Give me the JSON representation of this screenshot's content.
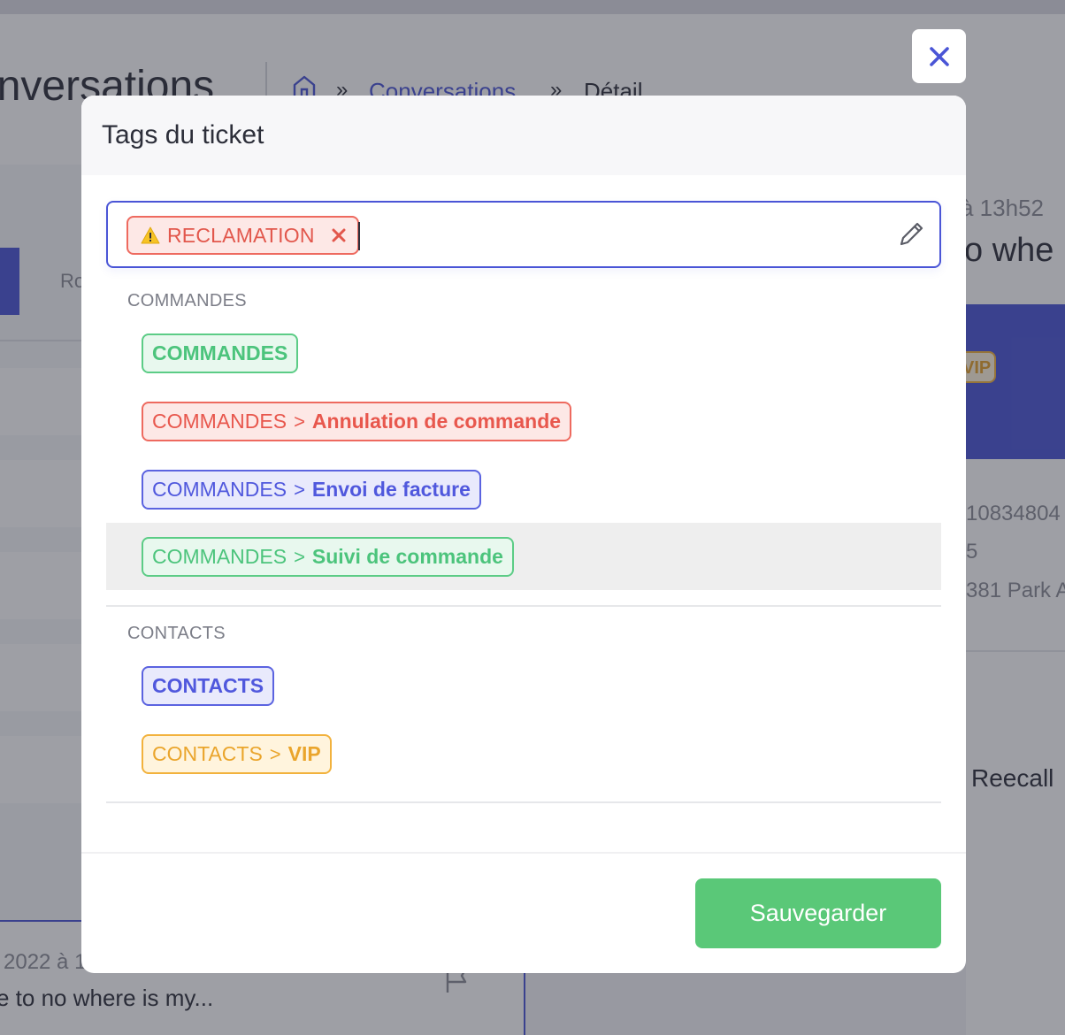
{
  "background": {
    "page_title": "onversations",
    "breadcrumb": {
      "link": "Conversations",
      "current": "Détail",
      "separator": "»"
    },
    "left": {
      "tab_label": "Ro",
      "card_date": "2022 à 1",
      "card_text": "e to no where is my..."
    },
    "right": {
      "time": "à 13h52",
      "heading": "o whe",
      "vip_badge": "VIP",
      "info_1": "10834804",
      "info_2": "5",
      "info_3": "381 Park A",
      "reecall": "Reecall"
    }
  },
  "modal": {
    "title": "Tags du ticket",
    "selected_tag": {
      "label": "RECLAMATION",
      "icon": "warning-icon"
    },
    "groups": [
      {
        "label": "COMMANDES",
        "options": [
          {
            "root": "COMMANDES",
            "child": ""
          },
          {
            "root": "COMMANDES",
            "child": "Annulation de commande"
          },
          {
            "root": "COMMANDES",
            "child": "Envoi de facture"
          },
          {
            "root": "COMMANDES",
            "child": "Suivi de commande"
          }
        ]
      },
      {
        "label": "CONTACTS",
        "options": [
          {
            "root": "CONTACTS",
            "child": ""
          },
          {
            "root": "CONTACTS",
            "child": "VIP"
          }
        ]
      }
    ],
    "save_label": "Sauvegarder"
  },
  "colors": {
    "accent": "#4a55d6",
    "save": "#5ac878",
    "green_tag": "#4cc47c",
    "red_tag": "#e8574d",
    "blue_tag": "#5058dd",
    "orange_tag": "#eaa52c"
  }
}
